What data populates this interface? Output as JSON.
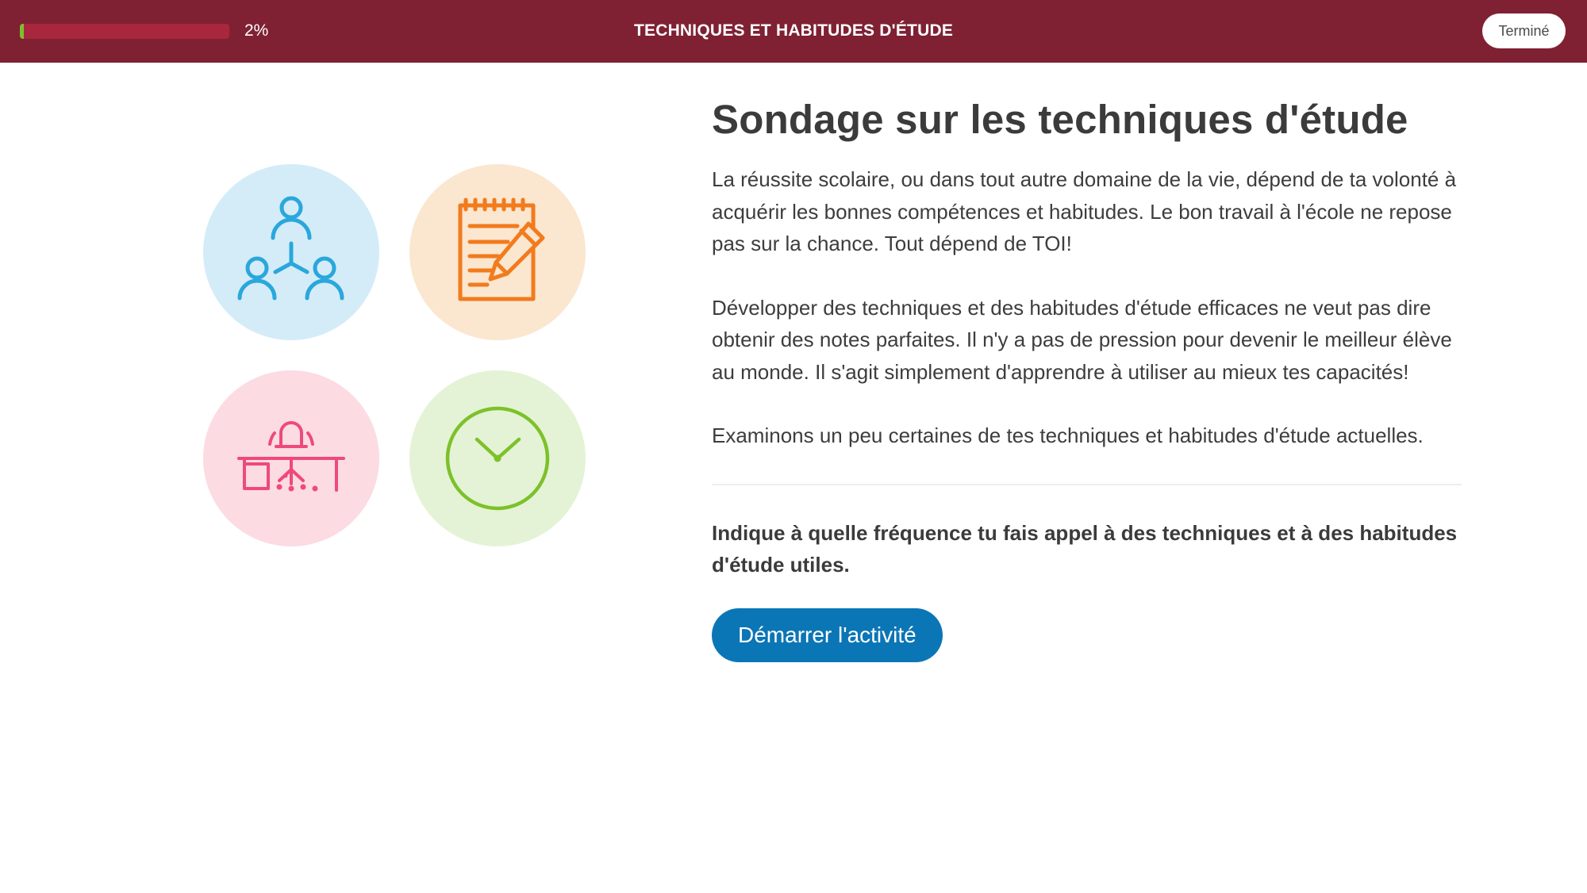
{
  "header": {
    "progress_percent": 2,
    "progress_label": "2%",
    "title": "TECHNIQUES ET HABITUDES D'ÉTUDE",
    "done_label": "Terminé"
  },
  "illustrations": {
    "icons": [
      "people-network-icon",
      "notepad-pencil-icon",
      "desk-chair-icon",
      "clock-icon"
    ],
    "colors": {
      "blue_bg": "#d4ecf8",
      "blue": "#2aa7dc",
      "orange_bg": "#fbe6cf",
      "orange": "#f27b1c",
      "pink_bg": "#fcdbe3",
      "pink": "#ee4a79",
      "green_bg": "#e4f3d6",
      "green": "#7dc12a"
    }
  },
  "main": {
    "title": "Sondage sur les techniques d'étude",
    "paragraphs": [
      "La réussite scolaire, ou dans tout autre domaine de la vie, dépend de ta volonté à acquérir les bonnes compétences et habitudes. Le bon travail à l'école ne repose pas sur la chance. Tout dépend de TOI!",
      "Développer des techniques et des habitudes d'étude efficaces ne veut pas dire obtenir des notes parfaites. Il n'y a pas de pression pour devenir le meilleur élève au monde. Il s'agit simplement d'apprendre à utiliser au mieux tes capacités!",
      "Examinons un peu certaines de tes techniques et habitudes d'étude actuelles."
    ],
    "question": "Indique à quelle fréquence tu fais appel à des techniques et à des habitudes d'étude utiles.",
    "start_label": "Démarrer l'activité"
  },
  "colors": {
    "header_bg": "#7f2133",
    "progress_track": "#a8273e",
    "progress_fill": "#7dc12a",
    "button_bg": "#0b76b6"
  }
}
